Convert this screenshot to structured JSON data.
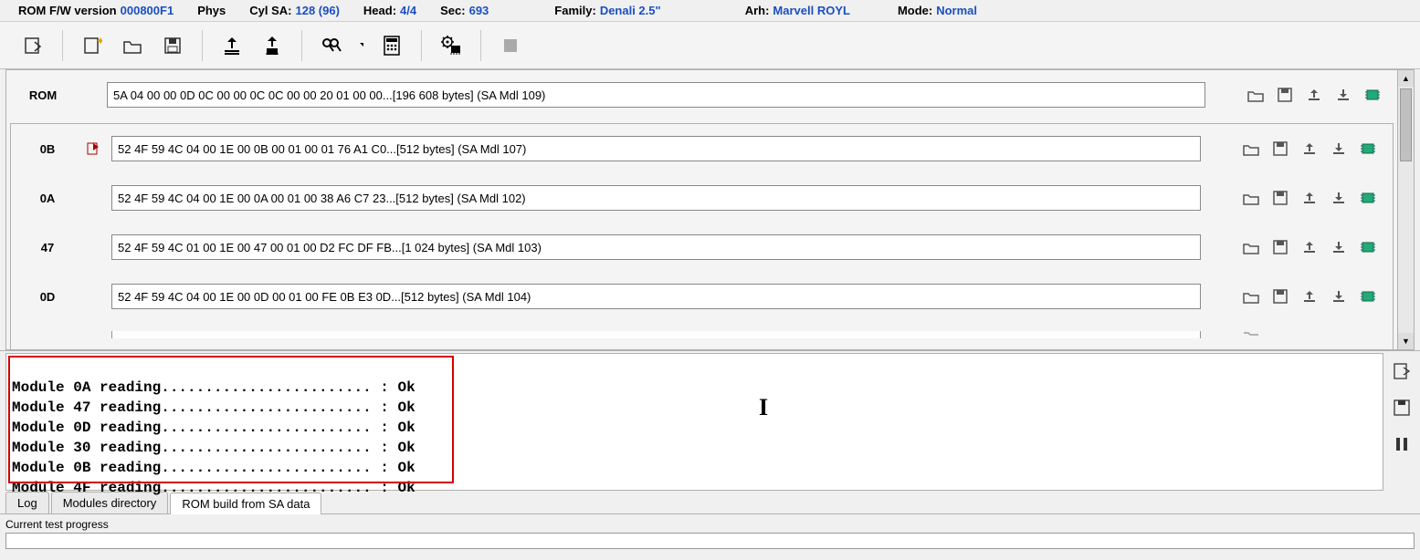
{
  "info": {
    "rom_fw_label": "ROM F/W version",
    "rom_fw_value": "000800F1",
    "phys_label": "Phys",
    "cylsa_label": "Cyl SA:",
    "cylsa_value": "128 (96)",
    "head_label": "Head:",
    "head_value": "4/4",
    "sec_label": "Sec:",
    "sec_value": "693",
    "family_label": "Family:",
    "family_value": "Denali 2.5\"",
    "arh_label": "Arh:",
    "arh_value": "Marvell ROYL",
    "mode_label": "Mode:",
    "mode_value": "Normal"
  },
  "rom": {
    "label": "ROM",
    "value": "5A 04 00 00 0D 0C 00 00 0C 0C 00 00 20 01 00 00...[196 608 bytes] (SA Mdl 109)"
  },
  "modules": [
    {
      "id": "0B",
      "flag": true,
      "value": "52 4F 59 4C 04 00 1E 00 0B 00 01 00 01 76 A1 C0...[512 bytes] (SA Mdl 107)"
    },
    {
      "id": "0A",
      "flag": false,
      "value": "52 4F 59 4C 04 00 1E 00 0A 00 01 00 38 A6 C7 23...[512 bytes] (SA Mdl 102)"
    },
    {
      "id": "47",
      "flag": false,
      "value": "52 4F 59 4C 01 00 1E 00 47 00 01 00 D2 FC DF FB...[1 024 bytes] (SA Mdl 103)"
    },
    {
      "id": "0D",
      "flag": false,
      "value": "52 4F 59 4C 04 00 1E 00 0D 00 01 00 FE 0B E3 0D...[512 bytes] (SA Mdl 104)"
    }
  ],
  "log_lines": [
    "Module 0A reading........................ : Ok",
    "Module 47 reading........................ : Ok",
    "Module 0D reading........................ : Ok",
    "Module 30 reading........................ : Ok",
    "Module 0B reading........................ : Ok",
    "Module 4F reading........................ : Ok"
  ],
  "tabs": {
    "log": "Log",
    "modules_dir": "Modules directory",
    "rom_build": "ROM build from SA data"
  },
  "progress_label": "Current test progress"
}
